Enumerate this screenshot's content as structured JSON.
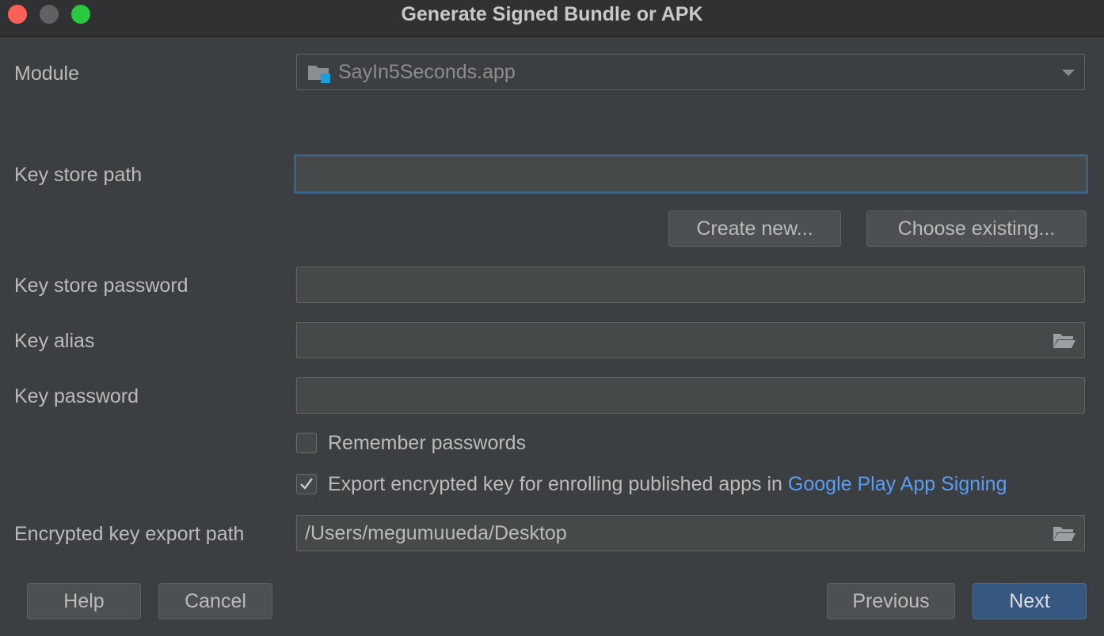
{
  "window": {
    "title": "Generate Signed Bundle or APK"
  },
  "form": {
    "module": {
      "label": "Module",
      "value": "SayIn5Seconds.app",
      "icon": "module-folder-icon"
    },
    "key_store_path": {
      "label": "Key store path",
      "value": ""
    },
    "create_new_label": "Create new...",
    "choose_existing_label": "Choose existing...",
    "key_store_password": {
      "label": "Key store password",
      "value": ""
    },
    "key_alias": {
      "label": "Key alias",
      "value": "",
      "icon": "folder-open-icon"
    },
    "key_password": {
      "label": "Key password",
      "value": ""
    },
    "remember_passwords": {
      "label": "Remember passwords",
      "checked": false
    },
    "export_encrypted": {
      "label": "Export encrypted key for enrolling published apps in",
      "link": "Google Play App Signing",
      "checked": true
    },
    "encrypted_export_path": {
      "label": "Encrypted key export path",
      "value": "/Users/megumuueda/Desktop",
      "icon": "folder-open-icon"
    }
  },
  "footer": {
    "help_label": "Help",
    "cancel_label": "Cancel",
    "previous_label": "Previous",
    "next_label": "Next"
  },
  "colors": {
    "background": "#3c3f41",
    "accent": "#365880",
    "link": "#589df6",
    "focus_border": "#3d6185"
  }
}
